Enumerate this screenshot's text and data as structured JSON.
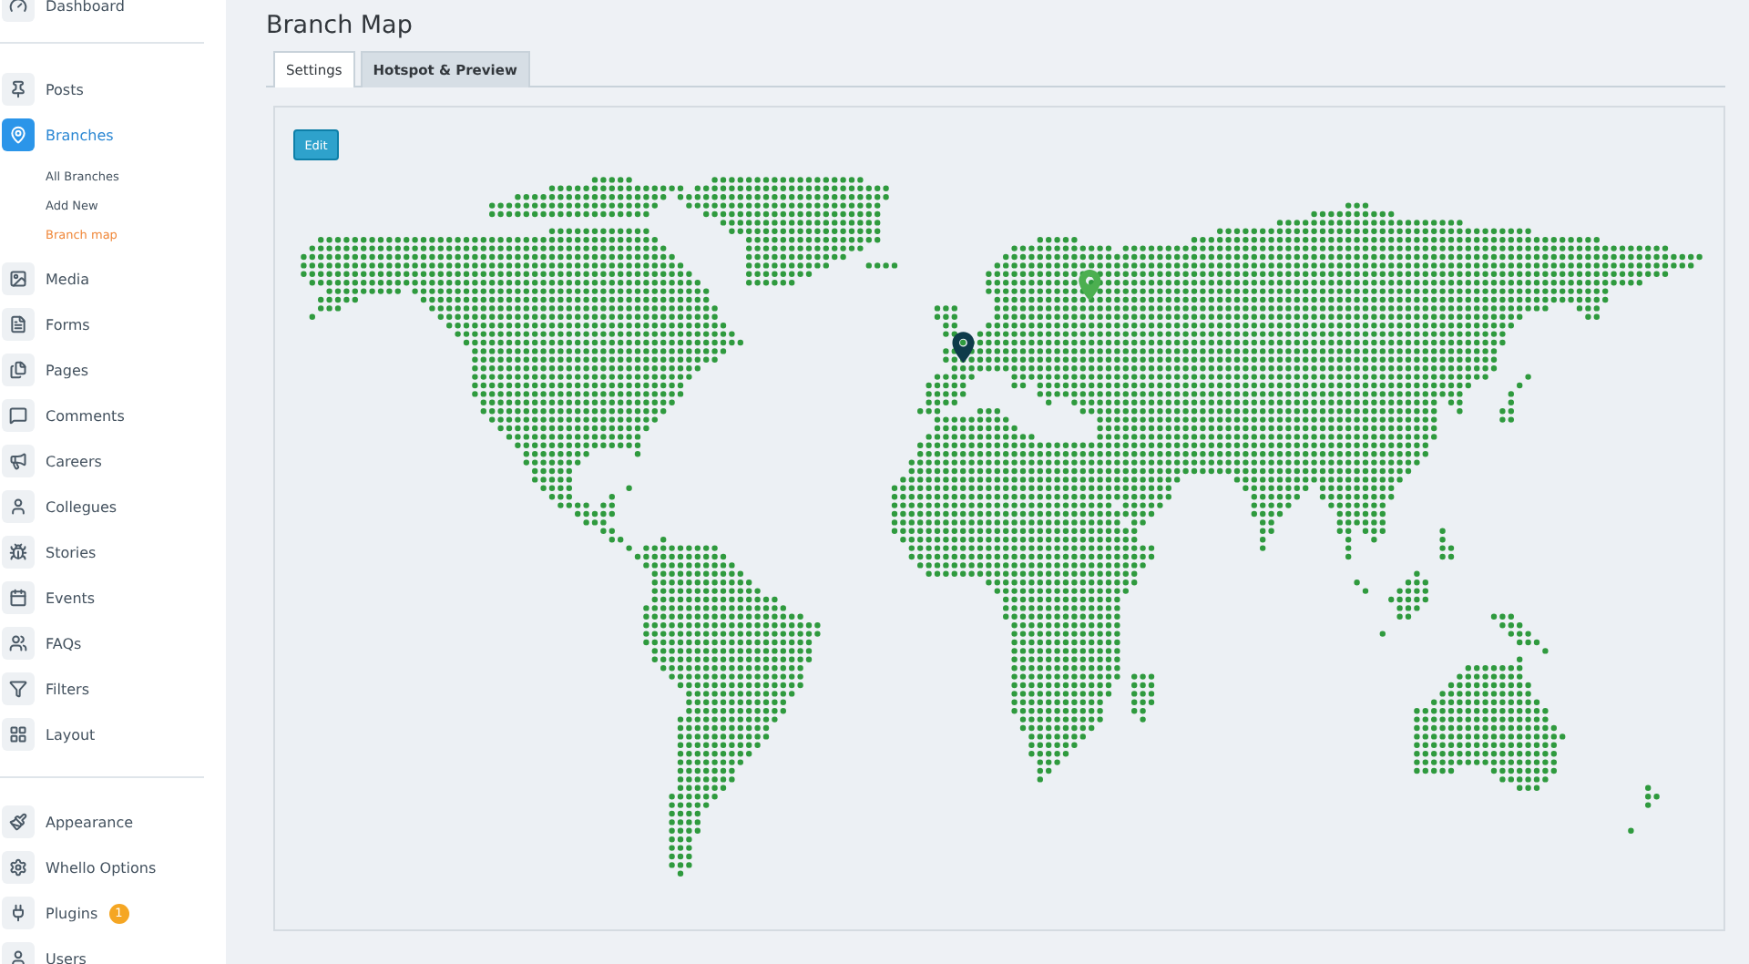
{
  "sidebar": {
    "groups": [
      {
        "items": [
          {
            "label": "Dashboard",
            "selected": false
          }
        ]
      },
      {
        "items": [
          {
            "label": "Posts",
            "selected": false
          },
          {
            "label": "Branches",
            "selected": true,
            "children": [
              {
                "label": "All Branches",
                "selected": false
              },
              {
                "label": "Add New",
                "selected": false
              },
              {
                "label": "Branch map",
                "selected": true
              }
            ]
          },
          {
            "label": "Media",
            "selected": false
          },
          {
            "label": "Forms",
            "selected": false
          },
          {
            "label": "Pages",
            "selected": false
          },
          {
            "label": "Comments",
            "selected": false
          },
          {
            "label": "Careers",
            "selected": false
          },
          {
            "label": "Collegues",
            "selected": false
          },
          {
            "label": "Stories",
            "selected": false
          },
          {
            "label": "Events",
            "selected": false
          },
          {
            "label": "FAQs",
            "selected": false
          },
          {
            "label": "Filters",
            "selected": false
          },
          {
            "label": "Layout",
            "selected": false
          }
        ]
      },
      {
        "items": [
          {
            "label": "Appearance",
            "selected": false
          },
          {
            "label": "Whello Options",
            "selected": false
          },
          {
            "label": "Plugins",
            "selected": false,
            "badge": "1"
          },
          {
            "label": "Users",
            "selected": false
          }
        ]
      }
    ]
  },
  "page": {
    "title": "Branch Map",
    "tabs": [
      {
        "label": "Settings",
        "selected": false
      },
      {
        "label": "Hotspot & Preview",
        "selected": true
      }
    ],
    "edit_button": "Edit",
    "map": {
      "pins": [
        {
          "color": "#4caf50"
        },
        {
          "color": "#0e3b4a"
        }
      ]
    }
  }
}
